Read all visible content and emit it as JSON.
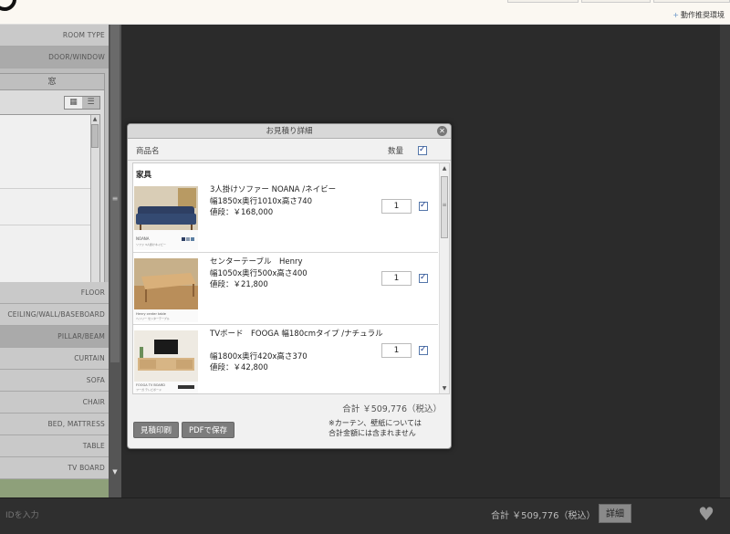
{
  "topbar": {
    "env_link": "動作推奨環境"
  },
  "sidebar": {
    "items_top": [
      "ROOM TYPE",
      "DOOR/WINDOW"
    ],
    "panel_title": "窓",
    "view_icons": [
      "grid-view-icon",
      "list-view-icon"
    ],
    "items_bottom": [
      "FLOOR",
      "CEILING/WALL/BASEBOARD",
      "PILLAR/BEAM",
      "CURTAIN",
      "SOFA",
      "CHAIR",
      "BED, MATTRESS",
      "TABLE",
      "TV BOARD"
    ]
  },
  "bottombar": {
    "id_placeholder": "IDを入力",
    "total": "合計 ￥509,776（税込）",
    "detail_button": "詳細"
  },
  "modal": {
    "title": "お見積り詳細",
    "col_name": "商品名",
    "col_qty": "数量",
    "category": "家具",
    "items": [
      {
        "name": "3人掛けソファー NOANA /ネイビー",
        "size": "幅1850x奥行1010x高さ740",
        "price": "値段：￥168,000",
        "qty": "1",
        "thumb_caption": "NOANA",
        "thumb_caption2": "ソファ 3人掛けネイビー"
      },
      {
        "name": "センターテーブル　Henry",
        "size": "幅1050x奥行500x高さ400",
        "price": "値段：￥21,800",
        "qty": "1",
        "thumb_caption": "Henry center table",
        "thumb_caption2": "ヘンリー センターテーブル"
      },
      {
        "name": "TVボード　FOOGA 幅180cmタイプ /ナチュラル",
        "size": "幅1800x奥行420x高さ370",
        "price": "値段：￥42,800",
        "qty": "1",
        "thumb_caption": "FOOGA TV BOARD",
        "thumb_caption2": "フーガ テレビボード"
      }
    ],
    "total": "合計 ￥509,776（税込）",
    "print_button": "見積印刷",
    "pdf_button": "PDFで保存",
    "note_line1": "※カーテン、壁紙については",
    "note_line2": "合計金額には含まれません"
  },
  "colors": {
    "background": "#2b2b2b",
    "sidebar": "#bdbdbd",
    "accent_green": "#8ea07a",
    "checkbox": "#1a3b8a"
  }
}
